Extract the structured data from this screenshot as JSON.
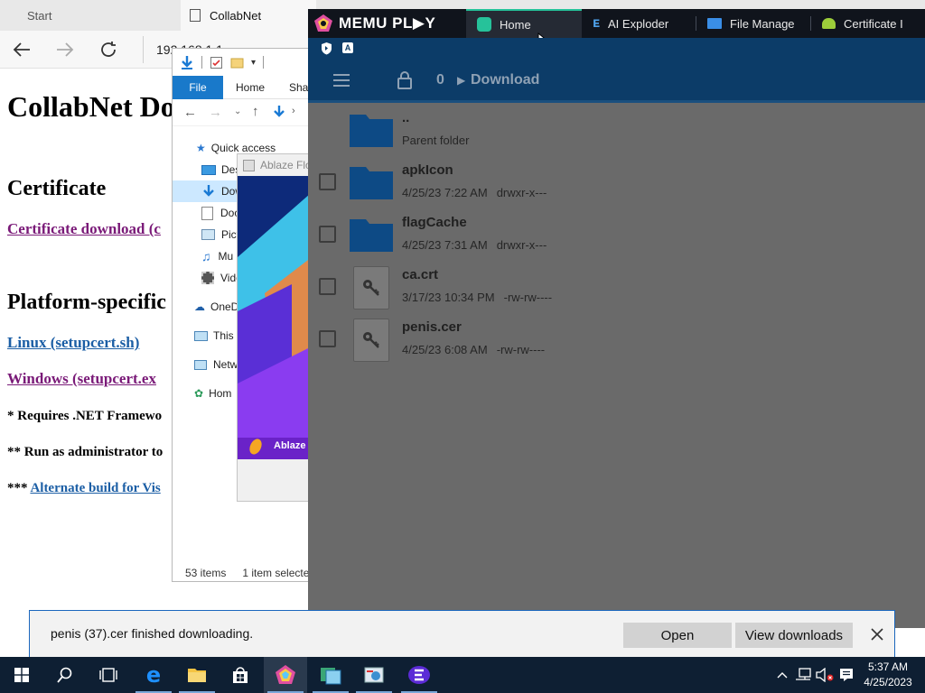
{
  "browser": {
    "tabs": [
      {
        "label": "Start",
        "active": false
      },
      {
        "label": "CollabNet",
        "active": true
      }
    ],
    "address": "192.168.1.1",
    "page": {
      "title": "CollabNet Do",
      "certificate_heading": "Certificate",
      "certificate_link": "Certificate download (c",
      "platform_heading": "Platform-specific",
      "linux_link": "Linux (setupcert.sh)",
      "windows_link": "Windows (setupcert.ex",
      "note1": "* Requires .NET Framewo",
      "note2": "** Run as administrator to",
      "note3_prefix": "***",
      "note3_link": "Alternate build for Vis"
    }
  },
  "explorer": {
    "ribbon_tabs": [
      "File",
      "Home",
      "Shar"
    ],
    "tree": [
      "Quick access",
      "Des",
      "Dow",
      "Doc",
      "Pict",
      "Mu",
      "Vide",
      "OneD",
      "This",
      "Netw",
      "Hom"
    ],
    "status_items": "53 items",
    "status_selected": "1 item selecte"
  },
  "ablaze": {
    "title": "Ablaze Flo",
    "brand": "Ablaze"
  },
  "memu": {
    "logo": "MEMU PL▶Y",
    "tabs": [
      {
        "label": "Home",
        "icon": "memu-home-icon",
        "active": true
      },
      {
        "label": "AI Exploder",
        "icon": "browser-icon",
        "active": false
      },
      {
        "label": "File Manage",
        "icon": "folder-icon",
        "active": false
      },
      {
        "label": "Certificate I",
        "icon": "android-icon",
        "active": false
      }
    ],
    "path_root": "0",
    "path_current": "Download",
    "files": [
      {
        "name": "..",
        "meta": "Parent folder",
        "perms": "",
        "type": "folder"
      },
      {
        "name": "apkIcon",
        "meta": "4/25/23 7:22 AM",
        "perms": "drwxr-x---",
        "type": "folder"
      },
      {
        "name": "flagCache",
        "meta": "4/25/23 7:31 AM",
        "perms": "drwxr-x---",
        "type": "folder"
      },
      {
        "name": "ca.crt",
        "meta": "3/17/23 10:34 PM",
        "perms": "-rw-rw----",
        "type": "file"
      },
      {
        "name": "penis.cer",
        "meta": "4/25/23 6:08 AM",
        "perms": "-rw-rw----",
        "type": "file"
      }
    ]
  },
  "download_bar": {
    "message": "penis (37).cer finished downloading.",
    "open_label": "Open",
    "view_label": "View downloads"
  },
  "taskbar": {
    "apps": [
      "start-icon",
      "search-icon",
      "task-view-icon",
      "edge-icon",
      "file-explorer-icon",
      "store-icon",
      "memu-icon",
      "memu-multi-icon",
      "control-panel-icon",
      "ablaze-icon"
    ],
    "time": "5:37 AM",
    "date": "4/25/2023"
  },
  "colors": {
    "memu_header": "#0c3c68",
    "memu_overlay": "#6a6a6a",
    "folder_blue": "#0d4a85",
    "explorer_file_tab": "#1979ca",
    "taskbar": "#0e1f33"
  }
}
